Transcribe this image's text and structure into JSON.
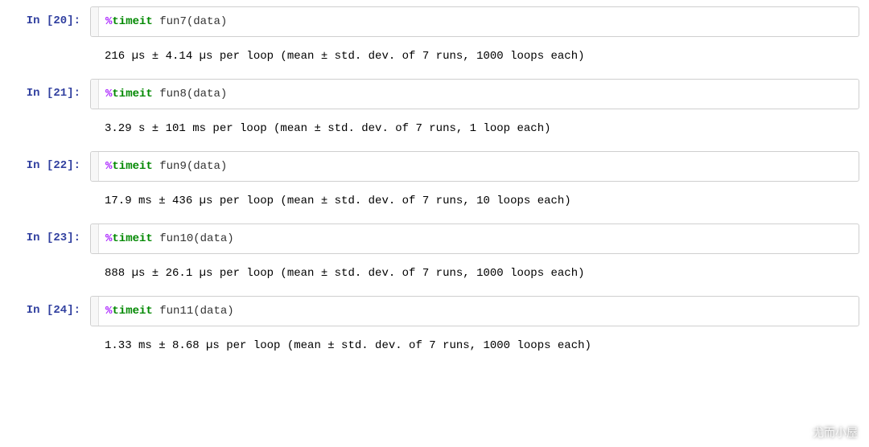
{
  "cells": [
    {
      "prompt_n": "20",
      "magic": "%",
      "magic_cmd": "timeit",
      "func": "fun7",
      "arg": "data",
      "output": "216 µs ± 4.14 µs per loop (mean ± std. dev. of 7 runs, 1000 loops each)"
    },
    {
      "prompt_n": "21",
      "magic": "%",
      "magic_cmd": "timeit",
      "func": "fun8",
      "arg": "data",
      "output": "3.29 s ± 101 ms per loop (mean ± std. dev. of 7 runs, 1 loop each)"
    },
    {
      "prompt_n": "22",
      "magic": "%",
      "magic_cmd": "timeit",
      "func": "fun9",
      "arg": "data",
      "output": "17.9 ms ± 436 µs per loop (mean ± std. dev. of 7 runs, 10 loops each)"
    },
    {
      "prompt_n": "23",
      "magic": "%",
      "magic_cmd": "timeit",
      "func": "fun10",
      "arg": "data",
      "output": "888 µs ± 26.1 µs per loop (mean ± std. dev. of 7 runs, 1000 loops each)"
    },
    {
      "prompt_n": "24",
      "magic": "%",
      "magic_cmd": "timeit",
      "func": "fun11",
      "arg": "data",
      "output": "1.33 ms ± 8.68 µs per loop (mean ± std. dev. of 7 runs, 1000 loops each)"
    }
  ],
  "prompt_labels": {
    "in_prefix": "In [",
    "in_suffix": "]:"
  },
  "watermark": {
    "text": "尤而小屋"
  }
}
